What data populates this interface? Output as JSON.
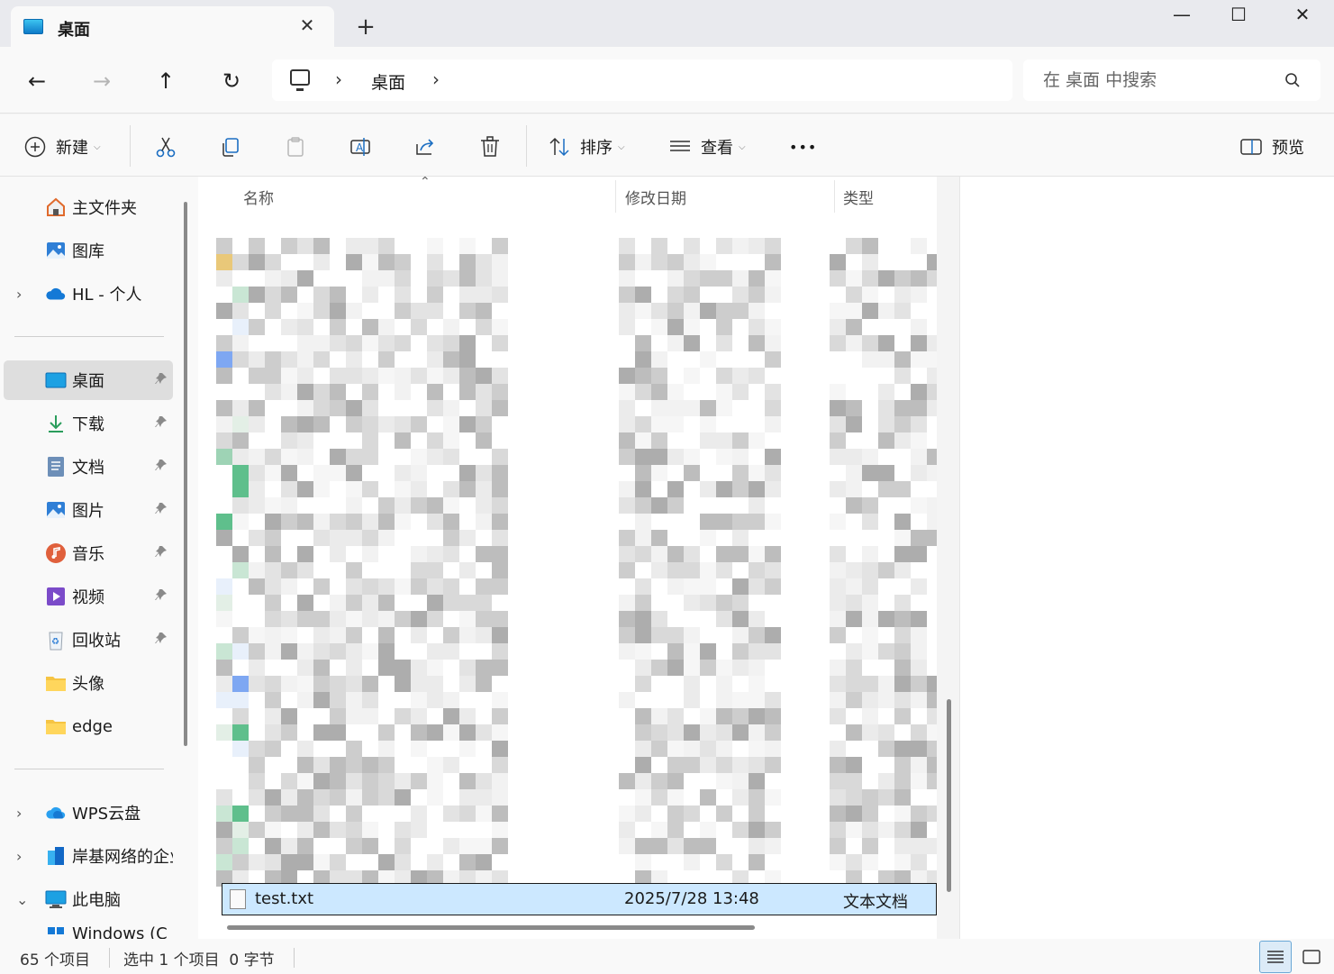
{
  "window": {
    "tab_title": "桌面",
    "tab_close": "✕",
    "new_tab": "+",
    "minimize": "—",
    "maximize": "☐",
    "close": "✕"
  },
  "nav": {
    "back": "←",
    "forward": "→",
    "up": "↑",
    "refresh": "↻",
    "breadcrumb": [
      "桌面"
    ],
    "search_placeholder": "在 桌面 中搜索"
  },
  "toolbar": {
    "new_label": "新建",
    "sort_label": "排序",
    "view_label": "查看",
    "more_label": "•••",
    "preview_label": "预览"
  },
  "sidebar": {
    "items": [
      {
        "label": "主文件夹",
        "icon": "home-icon"
      },
      {
        "label": "图库",
        "icon": "gallery-icon"
      },
      {
        "label": "HL - 个人",
        "icon": "onedrive-icon"
      },
      {
        "label": "桌面",
        "icon": "desktop-icon"
      },
      {
        "label": "下载",
        "icon": "download-icon"
      },
      {
        "label": "文档",
        "icon": "document-icon"
      },
      {
        "label": "图片",
        "icon": "pictures-icon"
      },
      {
        "label": "音乐",
        "icon": "music-icon"
      },
      {
        "label": "视频",
        "icon": "video-icon"
      },
      {
        "label": "回收站",
        "icon": "recycle-bin-icon"
      },
      {
        "label": "头像",
        "icon": "folder-icon"
      },
      {
        "label": "edge",
        "icon": "folder-icon"
      },
      {
        "label": "WPS云盘",
        "icon": "wps-cloud-icon"
      },
      {
        "label": "岸基网络的企业",
        "icon": "enterprise-icon"
      },
      {
        "label": "此电脑",
        "icon": "this-pc-icon"
      },
      {
        "label": "Windows (C",
        "icon": "drive-icon"
      }
    ],
    "chevron_right": "›",
    "chevron_down": "⌄",
    "pin": "📌"
  },
  "file_list": {
    "columns": [
      "名称",
      "修改日期",
      "类型"
    ],
    "selected_row": {
      "name": "test.txt",
      "date": "2025/7/28 13:48",
      "type": "文本文档"
    }
  },
  "status": {
    "item_count": "65 个项目",
    "selection": "选中 1 个项目  0 字节"
  },
  "colors": {
    "accent": "#0067c0",
    "selected_row": "#cce8ff",
    "sidebar_selected": "#dedede"
  }
}
